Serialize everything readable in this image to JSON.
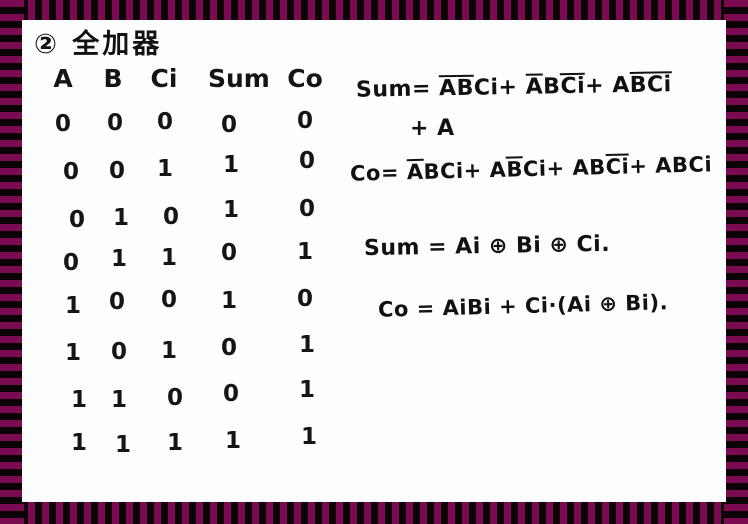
{
  "document": {
    "title": "② 全加器",
    "ink_color": "#111111",
    "paper_color": "#fdfdfd",
    "border_colors": [
      "#7b0b50",
      "#0a0206"
    ]
  },
  "truth_table": {
    "headers": [
      "A",
      "B",
      "Ci",
      "Sum",
      "Co"
    ],
    "rows": [
      [
        "0",
        "0",
        "0",
        "0",
        "0"
      ],
      [
        "0",
        "0",
        "1",
        "1",
        "0"
      ],
      [
        "0",
        "1",
        "0",
        "1",
        "0"
      ],
      [
        "0",
        "1",
        "1",
        "0",
        "1"
      ],
      [
        "1",
        "0",
        "0",
        "1",
        "0"
      ],
      [
        "1",
        "0",
        "1",
        "0",
        "1"
      ],
      [
        "1",
        "1",
        "0",
        "0",
        "1"
      ],
      [
        "1",
        "1",
        "1",
        "1",
        "1"
      ]
    ]
  },
  "equations": {
    "sum_sop": {
      "lhs": "Sum",
      "eq": "=",
      "terms": [
        {
          "vars": [
            {
              "sym": "A",
              "bar": true
            },
            {
              "sym": "B",
              "bar": true
            },
            {
              "sym": "Ci",
              "bar": false
            }
          ]
        },
        {
          "vars": [
            {
              "sym": "A",
              "bar": true
            },
            {
              "sym": "B",
              "bar": false
            },
            {
              "sym": "Ci",
              "bar": true
            }
          ]
        },
        {
          "vars": [
            {
              "sym": "A",
              "bar": false
            },
            {
              "sym": "B",
              "bar": true
            },
            {
              "sym": "Ci",
              "bar": true
            }
          ]
        }
      ],
      "plain": "Sum = A̅B̅Ci + A̅BC̅i + AB̅C̅i"
    },
    "sum_sop_continuation": "+ A",
    "co_sop": {
      "lhs": "Co",
      "eq": "=",
      "terms": [
        {
          "vars": [
            {
              "sym": "A",
              "bar": true
            },
            {
              "sym": "B",
              "bar": false
            },
            {
              "sym": "Ci",
              "bar": false
            }
          ]
        },
        {
          "vars": [
            {
              "sym": "A",
              "bar": false
            },
            {
              "sym": "B",
              "bar": true
            },
            {
              "sym": "Ci",
              "bar": false
            }
          ]
        },
        {
          "vars": [
            {
              "sym": "A",
              "bar": false
            },
            {
              "sym": "B",
              "bar": false
            },
            {
              "sym": "Ci",
              "bar": true
            }
          ]
        },
        {
          "vars": [
            {
              "sym": "A",
              "bar": false
            },
            {
              "sym": "B",
              "bar": false
            },
            {
              "sym": "Ci",
              "bar": false
            }
          ]
        }
      ],
      "plain": "Co = A̅BCi + AB̅Ci + ABC̅i + ABCi"
    },
    "sum_xor": "Sum = Ai ⊕ Bi ⊕ Ci.",
    "co_xor": "Co = AiBi + Ci·(Ai ⊕ Bi)."
  }
}
